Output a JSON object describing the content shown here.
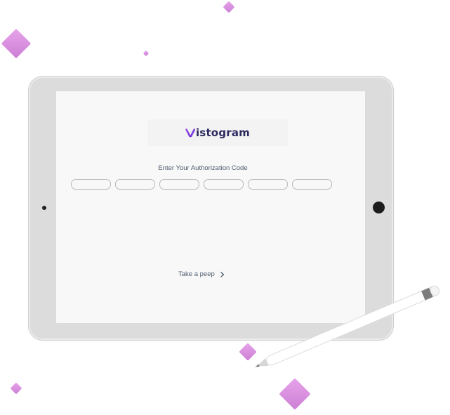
{
  "app": {
    "logo_text": "istogram",
    "logo_mark_letter": "V"
  },
  "auth": {
    "prompt": "Enter Your Authorization Code",
    "code_fields": [
      "",
      "",
      "",
      "",
      "",
      ""
    ]
  },
  "actions": {
    "peep_label": "Take a peep"
  },
  "colors": {
    "accent": "#7b3fe4",
    "logo_text": "#2c2a5e",
    "diamond": "#d48ddb",
    "label_text": "#4d5c6f"
  },
  "icons": {
    "peep": "chevron-right-icon",
    "logo": "v-logo-icon"
  }
}
